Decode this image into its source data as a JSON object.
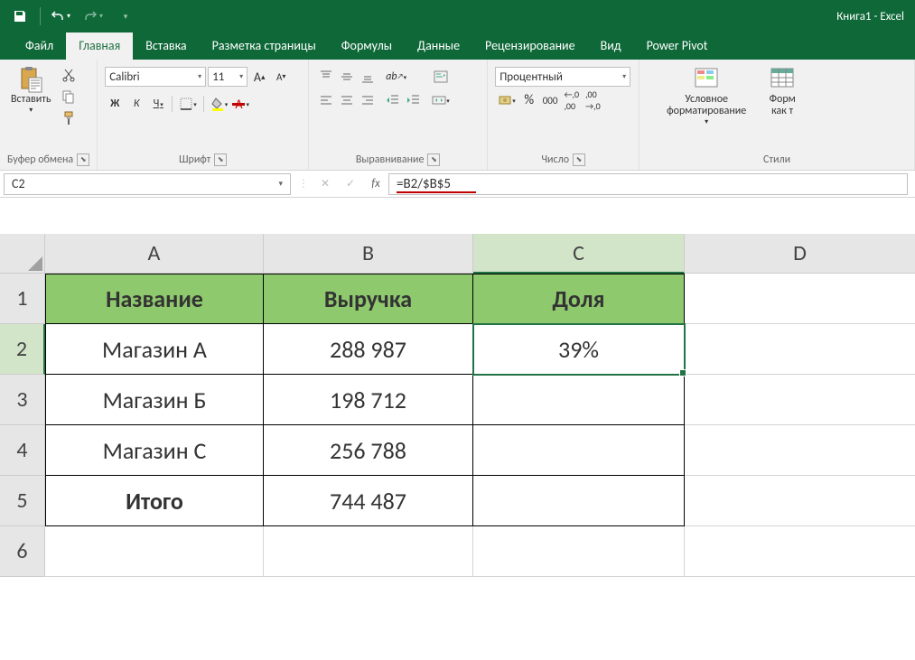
{
  "app_title": "Книга1 - Excel",
  "tabs": [
    "Файл",
    "Главная",
    "Вставка",
    "Разметка страницы",
    "Формулы",
    "Данные",
    "Рецензирование",
    "Вид",
    "Power Pivot"
  ],
  "active_tab": 1,
  "ribbon": {
    "clipboard": {
      "label": "Буфер обмена",
      "paste": "Вставить"
    },
    "font": {
      "label": "Шрифт",
      "name": "Calibri",
      "size": "11",
      "bold": "Ж",
      "italic": "К",
      "underline": "Ч"
    },
    "alignment": {
      "label": "Выравнивание"
    },
    "number": {
      "label": "Число",
      "format": "Процентный",
      "percent": "%",
      "thousands": "000"
    },
    "styles": {
      "label": "Стили",
      "cond_fmt": "Условное\nформатирование",
      "fmt_as": "Форм\nкак т"
    }
  },
  "name_box": "C2",
  "formula": "=B2/$B$5",
  "columns": [
    "A",
    "B",
    "C",
    "D"
  ],
  "rows": [
    {
      "n": "1",
      "cells": [
        "Название",
        "Выручка",
        "Доля",
        ""
      ],
      "header": true
    },
    {
      "n": "2",
      "cells": [
        "Магазин А",
        "288 987",
        "39%",
        ""
      ],
      "active_col": 2
    },
    {
      "n": "3",
      "cells": [
        "Магазин Б",
        "198 712",
        "",
        ""
      ]
    },
    {
      "n": "4",
      "cells": [
        "Магазин С",
        "256 788",
        "",
        ""
      ]
    },
    {
      "n": "5",
      "cells": [
        "Итого",
        "744 487",
        "",
        ""
      ],
      "bold_first": true
    },
    {
      "n": "6",
      "cells": [
        "",
        "",
        "",
        ""
      ]
    }
  ],
  "active_cell": {
    "row": 2,
    "col": "C"
  }
}
